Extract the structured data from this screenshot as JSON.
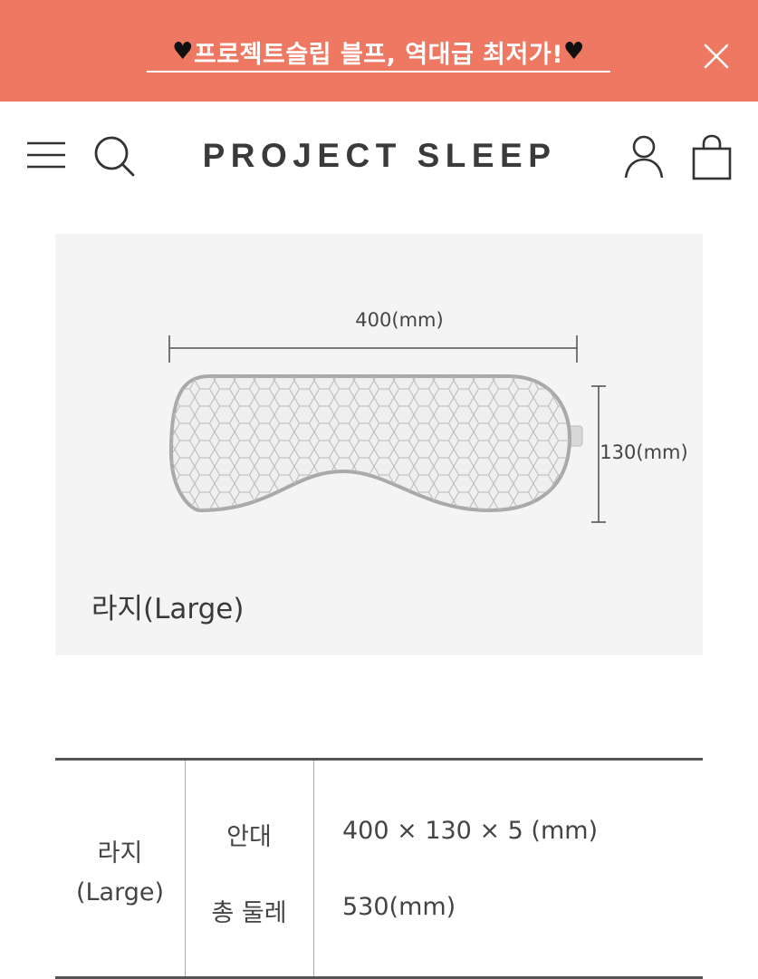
{
  "banner": {
    "text": "프로젝트슬립 블프, 역대급 최저가!",
    "heart_icon": "black-heart",
    "close_icon": "close-icon",
    "bg_color": "#ee7862"
  },
  "header": {
    "logo": "PROJECT SLEEP",
    "icons": [
      "menu-icon",
      "search-icon",
      "user-icon",
      "shopping-bag-icon"
    ]
  },
  "size_image": {
    "width_label": "400(mm)",
    "height_label": "130(mm)",
    "size_name": "라지(Large)"
  },
  "spec_table": {
    "size_label_line1": "라지",
    "size_label_line2": "(Large)",
    "rows": [
      {
        "label": "안대",
        "value": "400 × 130 × 5 (mm)"
      },
      {
        "label": "총 둘레",
        "value": "530(mm)"
      }
    ]
  }
}
